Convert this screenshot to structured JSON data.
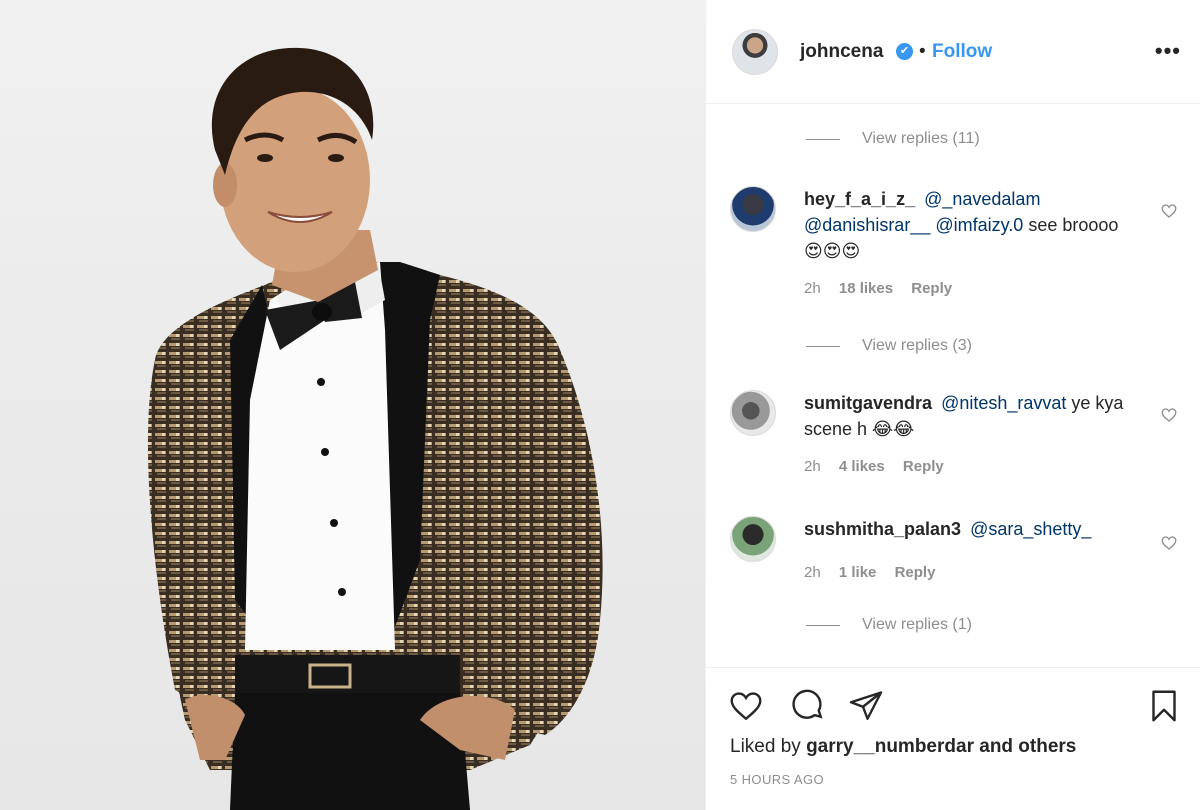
{
  "post": {
    "username": "johncena",
    "verified_mark": "✔",
    "separator": "•",
    "follow_label": "Follow",
    "more_label": "•••",
    "liked_by_prefix": "Liked by",
    "liked_by_user": "garry__numberdar",
    "liked_by_suffix": "and others",
    "timestamp": "5 HOURS AGO"
  },
  "view_replies": [
    {
      "label": "View replies (11)"
    },
    {
      "label": "View replies (3)"
    },
    {
      "label": "View replies (1)"
    }
  ],
  "comments": [
    {
      "username": "hey_f_a_i_z_",
      "mentions": [
        "@_navedalam",
        "@danishisrar__",
        "@imfaizy.0"
      ],
      "text": "see broooo😍😍😍",
      "time": "2h",
      "likes": "18 likes",
      "reply_label": "Reply"
    },
    {
      "username": "sumitgavendra",
      "mentions": [
        "@nitesh_ravvat"
      ],
      "text": "ye kya scene h 😂😂",
      "time": "2h",
      "likes": "4 likes",
      "reply_label": "Reply"
    },
    {
      "username": "sushmitha_palan3",
      "mentions": [
        "@sara_shetty_"
      ],
      "text": "",
      "time": "2h",
      "likes": "1 like",
      "reply_label": "Reply"
    }
  ],
  "icons": {
    "like": "heart-icon",
    "comment": "comment-icon",
    "share": "share-icon",
    "save": "bookmark-icon",
    "comment_like": "heart-icon"
  },
  "colors": {
    "link_blue": "#3897f0",
    "mention_blue": "#003569",
    "muted": "#8e8e8e",
    "text": "#262626"
  }
}
